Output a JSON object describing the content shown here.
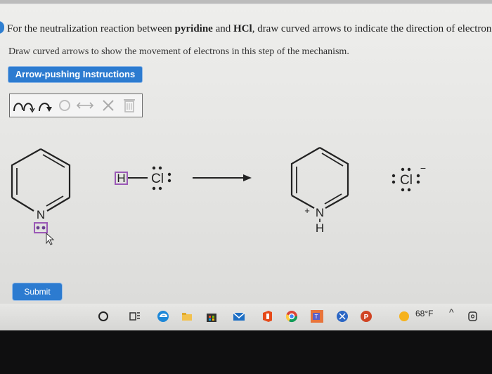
{
  "question": {
    "text_before_pyridine": "For the neutralization reaction between ",
    "pyridine": "pyridine",
    "text_and": " and ",
    "hcl": "HCl",
    "text_after": ", draw curved arrows to indicate the direction of electron flow"
  },
  "instruction": "Draw curved arrows to show the movement of electrons in this step of the mechanism.",
  "help_button_label": "Arrow-pushing Instructions",
  "toolbar": {
    "tools": [
      "curved-arrow-pair-icon",
      "curved-arrow-single-icon",
      "ring-icon",
      "double-headed-arrow-icon",
      "delete-x-icon",
      "trash-icon"
    ]
  },
  "mechanism": {
    "reactant_pyridine_atom": "N",
    "reactant_acid_h": "H",
    "reactant_acid_cl": "Cl",
    "product_n": "N",
    "product_h": "H",
    "product_charge_plus": "+",
    "product_chloride": "Cl",
    "product_chloride_charge": "−"
  },
  "submit_label": "Submit",
  "taskbar": {
    "weather_temp": "68°F",
    "icons": [
      "start-circle-icon",
      "task-view-icon",
      "edge-icon",
      "file-explorer-icon",
      "store-icon",
      "mail-icon",
      "office-icon",
      "chrome-icon",
      "teams-icon",
      "xbox-icon",
      "powerpoint-icon",
      "weather-sun-icon",
      "tray-chevron-icon",
      "onedrive-icon"
    ]
  },
  "colors": {
    "accent": "#2c7bd0",
    "selection_purple": "#9b59b6",
    "lone_pair_purple": "#6a3d8f"
  }
}
